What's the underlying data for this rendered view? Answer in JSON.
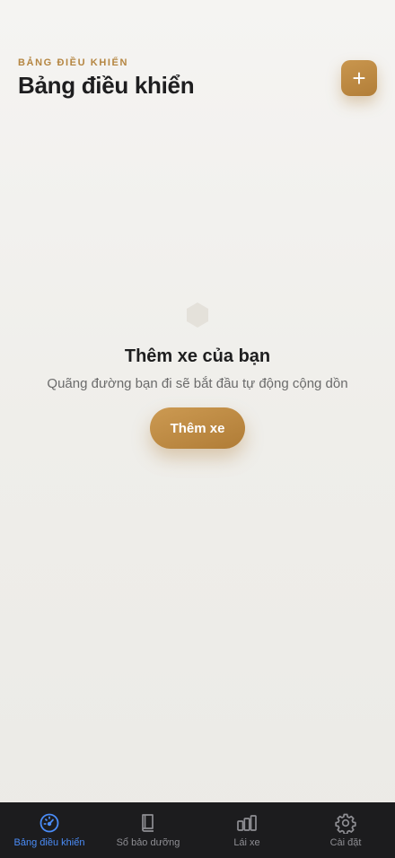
{
  "header": {
    "eyebrow": "BẢNG ĐIỀU KHIỂN",
    "title": "Bảng điều khiển",
    "add_icon": "plus-icon"
  },
  "empty_state": {
    "icon": "hexagon-icon",
    "title": "Thêm xe của bạn",
    "subtitle": "Quãng đường bạn đi sẽ bắt đầu tự động cộng dồn",
    "button_label": "Thêm xe"
  },
  "tabbar": {
    "items": [
      {
        "label": "Bảng điều khiển",
        "icon": "speedometer-icon",
        "active": true
      },
      {
        "label": "Sổ bảo dưỡng",
        "icon": "book-icon",
        "active": false
      },
      {
        "label": "Lái xe",
        "icon": "bar-chart-icon",
        "active": false
      },
      {
        "label": "Cài đặt",
        "icon": "gear-icon",
        "active": false
      }
    ]
  },
  "colors": {
    "accent": "#b58642",
    "tab_active": "#4a8cf7",
    "tab_inactive": "#8e8e93",
    "tabbar_bg": "#1c1c1e"
  }
}
